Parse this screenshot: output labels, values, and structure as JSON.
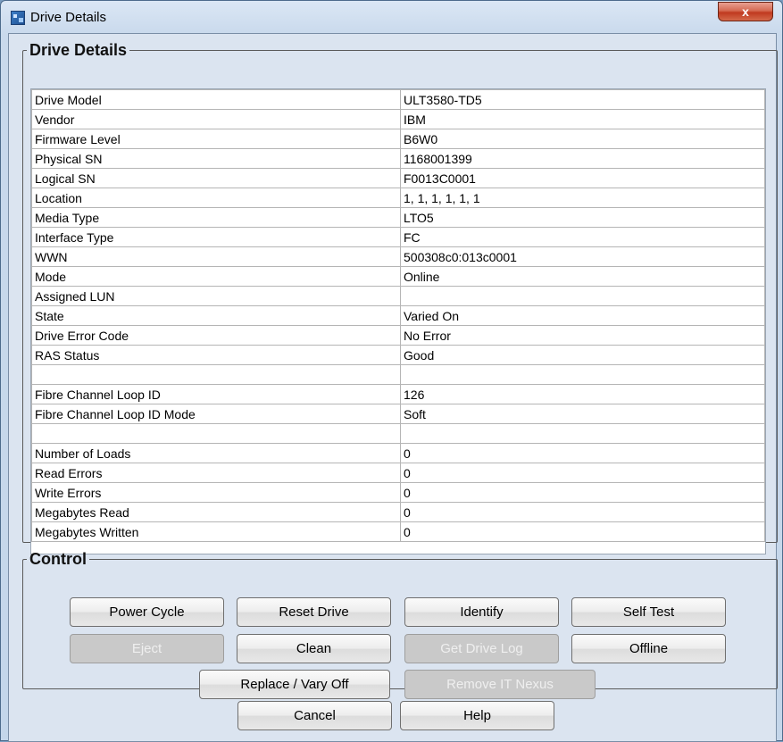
{
  "window": {
    "title": "Drive Details",
    "close_label": "x"
  },
  "details": {
    "legend": "Drive Details",
    "rows": [
      {
        "label": "Drive Model",
        "value": "ULT3580-TD5"
      },
      {
        "label": "Vendor",
        "value": "IBM"
      },
      {
        "label": "Firmware Level",
        "value": "B6W0"
      },
      {
        "label": "Physical SN",
        "value": "1168001399"
      },
      {
        "label": "Logical SN",
        "value": "F0013C0001"
      },
      {
        "label": "Location",
        "value": "1, 1, 1, 1, 1, 1"
      },
      {
        "label": "Media Type",
        "value": "LTO5"
      },
      {
        "label": "Interface Type",
        "value": "FC"
      },
      {
        "label": "WWN",
        "value": "500308c0:013c0001"
      },
      {
        "label": "Mode",
        "value": "Online"
      },
      {
        "label": "Assigned LUN",
        "value": ""
      },
      {
        "label": "State",
        "value": "Varied On"
      },
      {
        "label": "Drive Error Code",
        "value": "No Error"
      },
      {
        "label": "RAS Status",
        "value": "Good"
      },
      {
        "label": "",
        "value": ""
      },
      {
        "label": "Fibre Channel Loop ID",
        "value": "126"
      },
      {
        "label": "Fibre Channel Loop ID Mode",
        "value": "Soft"
      },
      {
        "label": "",
        "value": ""
      },
      {
        "label": "Number of Loads",
        "value": "0"
      },
      {
        "label": "Read Errors",
        "value": "0"
      },
      {
        "label": "Write Errors",
        "value": "0"
      },
      {
        "label": "Megabytes Read",
        "value": "0"
      },
      {
        "label": "Megabytes Written",
        "value": "0"
      }
    ]
  },
  "control": {
    "legend": "Control",
    "buttons": {
      "power_cycle": "Power Cycle",
      "reset_drive": "Reset Drive",
      "identify": "Identify",
      "self_test": "Self Test",
      "eject": "Eject",
      "clean": "Clean",
      "get_drive_log": "Get Drive Log",
      "offline": "Offline",
      "replace_vary_off": "Replace / Vary Off",
      "remove_it_nexus": "Remove IT Nexus"
    },
    "disabled": [
      "eject",
      "get_drive_log",
      "remove_it_nexus"
    ]
  },
  "footer": {
    "cancel": "Cancel",
    "help": "Help"
  },
  "colors": {
    "client_background": "#dbe4f0",
    "disabled_button": "#c9c9c9",
    "close_button": "#c0391f"
  }
}
